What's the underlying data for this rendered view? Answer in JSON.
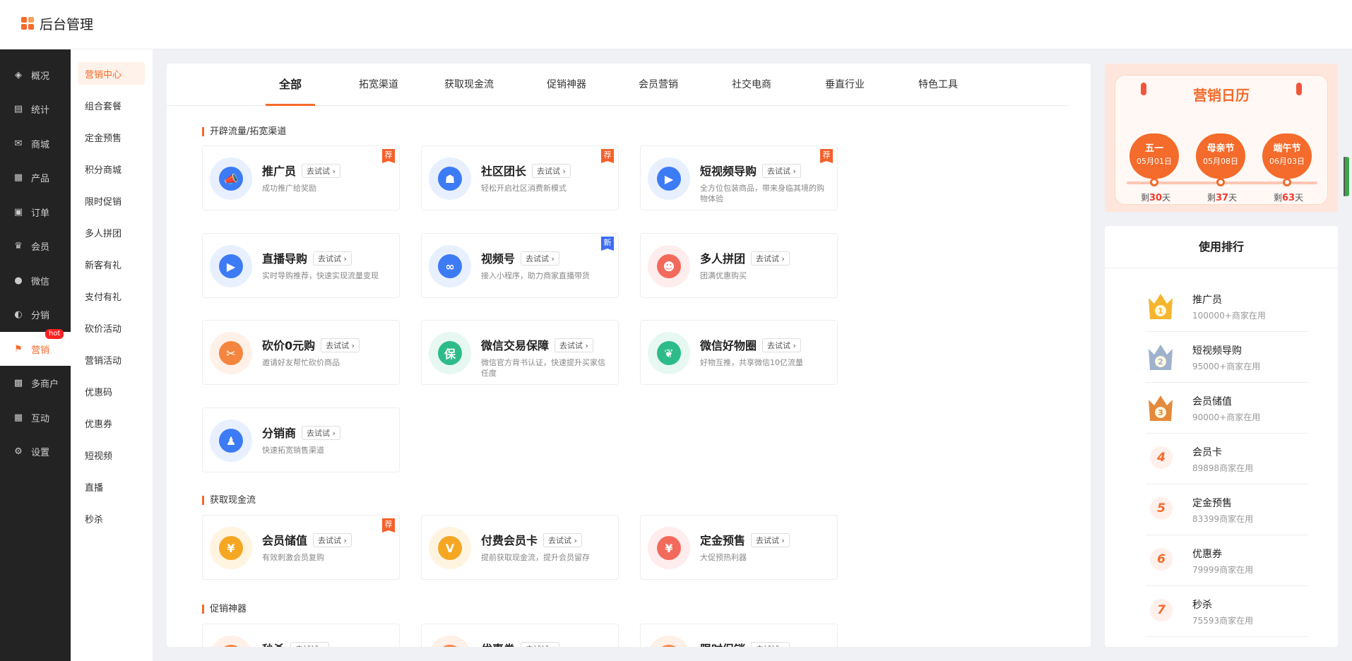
{
  "app": {
    "title": "后台管理"
  },
  "dark_nav": [
    {
      "label": "概况",
      "icon": "layers-icon",
      "glyph": "◈"
    },
    {
      "label": "统计",
      "icon": "chart-icon",
      "glyph": "▤"
    },
    {
      "label": "商城",
      "icon": "mail-icon",
      "glyph": "✉"
    },
    {
      "label": "产品",
      "icon": "grid-icon",
      "glyph": "▦"
    },
    {
      "label": "订单",
      "icon": "clipboard-icon",
      "glyph": "▣"
    },
    {
      "label": "会员",
      "icon": "crown-icon",
      "glyph": "♛"
    },
    {
      "label": "微信",
      "icon": "wechat-icon",
      "glyph": "●"
    },
    {
      "label": "分销",
      "icon": "user-icon",
      "glyph": "◐"
    },
    {
      "label": "营销",
      "icon": "flag-icon",
      "glyph": "⚑",
      "badge": "hot"
    },
    {
      "label": "多商户",
      "icon": "shop-icon",
      "glyph": "▩"
    },
    {
      "label": "互动",
      "icon": "apps-icon",
      "glyph": "▦"
    },
    {
      "label": "设置",
      "icon": "gear-icon",
      "glyph": "⚙"
    }
  ],
  "sub_nav": [
    "营销中心",
    "组合套餐",
    "定金预售",
    "积分商城",
    "限时促销",
    "多人拼团",
    "新客有礼",
    "支付有礼",
    "砍价活动",
    "营销活动",
    "优惠码",
    "优惠券",
    "短视频",
    "直播",
    "秒杀"
  ],
  "tabs": [
    "全部",
    "拓宽渠道",
    "获取现金流",
    "促销神器",
    "会员营销",
    "社交电商",
    "垂直行业",
    "特色工具"
  ],
  "try_label": "去试试 ›",
  "sections": [
    {
      "title": "开辟流量/拓宽渠道"
    },
    {
      "title": "获取现金流"
    },
    {
      "title": "促销神器"
    }
  ],
  "cards": [
    {
      "name": "推广员",
      "desc": "成功推广给奖励",
      "tag": "荐",
      "icon": "megaphone-icon",
      "glyph": "📣",
      "bg": "#e8f0ff",
      "fg": "#3d7bf5"
    },
    {
      "name": "社区团长",
      "desc": "轻松开启社区消费新模式",
      "tag": "荐",
      "icon": "community-icon",
      "glyph": "☗",
      "bg": "#e8f0ff",
      "fg": "#3d7bf5"
    },
    {
      "name": "短视频导购",
      "desc": "全方位包装商品，带来身临其境的购物体验",
      "tag": "荐",
      "icon": "video-bag-icon",
      "glyph": "▶",
      "bg": "#e8f0ff",
      "fg": "#3d7bf5"
    },
    {
      "name": "直播导购",
      "desc": "实时导购推荐，快速实现流量变现",
      "tag": "",
      "icon": "clapper-icon",
      "glyph": "▶",
      "bg": "#e8f0ff",
      "fg": "#3d7bf5"
    },
    {
      "name": "视频号",
      "desc": "接入小程序，助力商家直播带货",
      "tag": "新",
      "icon": "channels-icon",
      "glyph": "∞",
      "bg": "#e8f0ff",
      "fg": "#3d7bf5"
    },
    {
      "name": "多人拼团",
      "desc": "团满优惠购买",
      "tag": "",
      "icon": "group-icon",
      "glyph": "☻",
      "bg": "#ffecec",
      "fg": "#f26a5b"
    },
    {
      "name": "砍价0元购",
      "desc": "邀请好友帮忙砍价商品",
      "tag": "",
      "icon": "price-tag-icon",
      "glyph": "✂",
      "bg": "#fff0e8",
      "fg": "#f4853f"
    },
    {
      "name": "微信交易保障",
      "desc": "微信官方背书认证，快速提升买家信任度",
      "tag": "",
      "icon": "shield-icon",
      "glyph": "保",
      "bg": "#e6f8f1",
      "fg": "#2dbb8a"
    },
    {
      "name": "微信好物圈",
      "desc": "好物互推，共享微信10亿流量",
      "tag": "",
      "icon": "leaf-icon",
      "glyph": "❦",
      "bg": "#e6f8f1",
      "fg": "#2dbb8a"
    },
    {
      "name": "分销商",
      "desc": "快速拓宽销售渠道",
      "tag": "",
      "icon": "person-icon",
      "glyph": "♟",
      "bg": "#e8f0ff",
      "fg": "#3d7bf5"
    },
    {
      "name": "会员储值",
      "desc": "有效刺激会员复购",
      "tag": "荐",
      "icon": "coin-stack-icon",
      "glyph": "¥",
      "bg": "#fff4e0",
      "fg": "#f5a623"
    },
    {
      "name": "付费会员卡",
      "desc": "提前获取现金流，提升会员留存",
      "tag": "",
      "icon": "vip-card-icon",
      "glyph": "V",
      "bg": "#fff4e0",
      "fg": "#f5a623"
    },
    {
      "name": "定金预售",
      "desc": "大促预热利器",
      "tag": "",
      "icon": "deposit-icon",
      "glyph": "¥",
      "bg": "#ffecec",
      "fg": "#f26a5b"
    },
    {
      "name": "秒杀",
      "desc": "",
      "tag": "",
      "icon": "flash-icon",
      "glyph": "⚡",
      "bg": "#fff0e8",
      "fg": "#f4853f"
    },
    {
      "name": "优惠券",
      "desc": "",
      "tag": "",
      "icon": "coupon-icon",
      "glyph": "券",
      "bg": "#fff0e8",
      "fg": "#f4853f"
    },
    {
      "name": "限时促销",
      "desc": "",
      "tag": "",
      "icon": "timer-icon",
      "glyph": "◷",
      "bg": "#fff0e8",
      "fg": "#f4853f"
    }
  ],
  "calendar": {
    "title": "营销日历",
    "left_prefix": "剩",
    "left_suffix": "天",
    "festivals": [
      {
        "name": "五一",
        "date": "05月01日",
        "days": "30"
      },
      {
        "name": "母亲节",
        "date": "05月08日",
        "days": "37"
      },
      {
        "name": "端午节",
        "date": "06月03日",
        "days": "63"
      }
    ]
  },
  "ranking": {
    "title": "使用排行",
    "items": [
      {
        "rank": "1",
        "name": "推广员",
        "count": "100000+商家在用",
        "medal": "#f5b52e"
      },
      {
        "rank": "2",
        "name": "短视频导购",
        "count": "95000+商家在用",
        "medal": "#9fb2cc"
      },
      {
        "rank": "3",
        "name": "会员储值",
        "count": "90000+商家在用",
        "medal": "#e48a3c"
      },
      {
        "rank": "4",
        "name": "会员卡",
        "count": "89898商家在用"
      },
      {
        "rank": "5",
        "name": "定金预售",
        "count": "83399商家在用"
      },
      {
        "rank": "6",
        "name": "优惠券",
        "count": "79999商家在用"
      },
      {
        "rank": "7",
        "name": "秒杀",
        "count": "75593商家在用"
      }
    ]
  },
  "colors": {
    "accent": "#f46b2b",
    "sidebar": "#232323",
    "new_tag": "#3d6cf2"
  }
}
